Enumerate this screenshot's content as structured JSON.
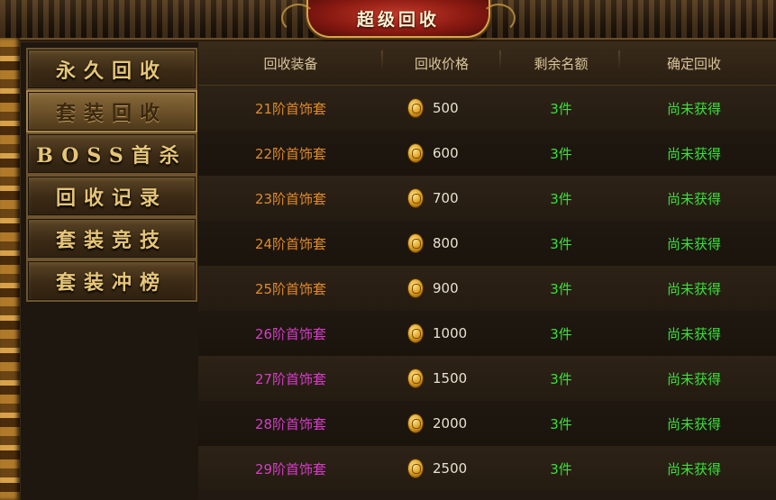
{
  "title": "超级回收",
  "sidebar": {
    "items": [
      {
        "label": "永久回收",
        "active": false
      },
      {
        "label": "套装回收",
        "active": true
      },
      {
        "label": "BOSS首杀",
        "active": false
      },
      {
        "label": "回收记录",
        "active": false
      },
      {
        "label": "套装竞技",
        "active": false
      },
      {
        "label": "套装冲榜",
        "active": false
      }
    ]
  },
  "table": {
    "headers": [
      "回收装备",
      "回收价格",
      "剩余名额",
      "确定回收"
    ],
    "rows": [
      {
        "name": "21阶首饰套",
        "price": "500",
        "remain": "3件",
        "status": "尚未获得",
        "color": "#e08a2a"
      },
      {
        "name": "22阶首饰套",
        "price": "600",
        "remain": "3件",
        "status": "尚未获得",
        "color": "#e08a2a"
      },
      {
        "name": "23阶首饰套",
        "price": "700",
        "remain": "3件",
        "status": "尚未获得",
        "color": "#e08a2a"
      },
      {
        "name": "24阶首饰套",
        "price": "800",
        "remain": "3件",
        "status": "尚未获得",
        "color": "#e08a2a"
      },
      {
        "name": "25阶首饰套",
        "price": "900",
        "remain": "3件",
        "status": "尚未获得",
        "color": "#e08a2a"
      },
      {
        "name": "26阶首饰套",
        "price": "1000",
        "remain": "3件",
        "status": "尚未获得",
        "color": "#d63cc8"
      },
      {
        "name": "27阶首饰套",
        "price": "1500",
        "remain": "3件",
        "status": "尚未获得",
        "color": "#d63cc8"
      },
      {
        "name": "28阶首饰套",
        "price": "2000",
        "remain": "3件",
        "status": "尚未获得",
        "color": "#d63cc8"
      },
      {
        "name": "29阶首饰套",
        "price": "2500",
        "remain": "3件",
        "status": "尚未获得",
        "color": "#d63cc8"
      }
    ]
  },
  "colors": {
    "accent_gold": "#e6c578",
    "status_green": "#39e03a",
    "name_orange": "#e08a2a",
    "name_purple": "#d63cc8"
  }
}
